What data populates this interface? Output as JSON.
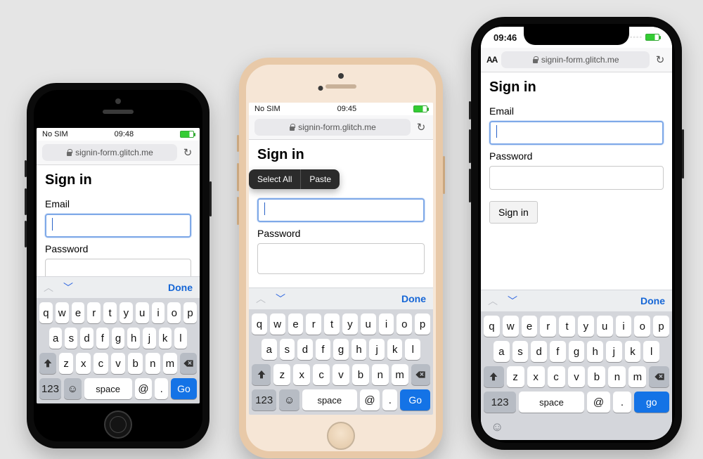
{
  "phones": [
    {
      "status": {
        "left": "No SIM",
        "time": "09:48"
      },
      "url": "signin-form.glitch.me",
      "page": {
        "heading": "Sign in",
        "email_label": "Email",
        "password_label": "Password"
      },
      "kb_acc_done": "Done",
      "menu": null,
      "submit": null
    },
    {
      "status": {
        "left": "No SIM",
        "time": "09:45"
      },
      "url": "signin-form.glitch.me",
      "page": {
        "heading": "Sign in",
        "email_label": "Email",
        "password_label": "Password"
      },
      "kb_acc_done": "Done",
      "menu": {
        "select_all": "Select All",
        "paste": "Paste"
      },
      "submit": null
    },
    {
      "status": {
        "left": "09:46",
        "time": ""
      },
      "url": "signin-form.glitch.me",
      "page": {
        "heading": "Sign in",
        "email_label": "Email",
        "password_label": "Password"
      },
      "kb_acc_done": "Done",
      "menu": null,
      "submit": "Sign in"
    }
  ],
  "keyboard": {
    "row1": [
      "q",
      "w",
      "e",
      "r",
      "t",
      "y",
      "u",
      "i",
      "o",
      "p"
    ],
    "row2": [
      "a",
      "s",
      "d",
      "f",
      "g",
      "h",
      "j",
      "k",
      "l"
    ],
    "row3": [
      "z",
      "x",
      "c",
      "v",
      "b",
      "n",
      "m"
    ],
    "k123": "123",
    "space": "space",
    "at": "@",
    "dot": ".",
    "go": "Go",
    "go_lc": "go"
  },
  "urlbar_aa": "AA"
}
